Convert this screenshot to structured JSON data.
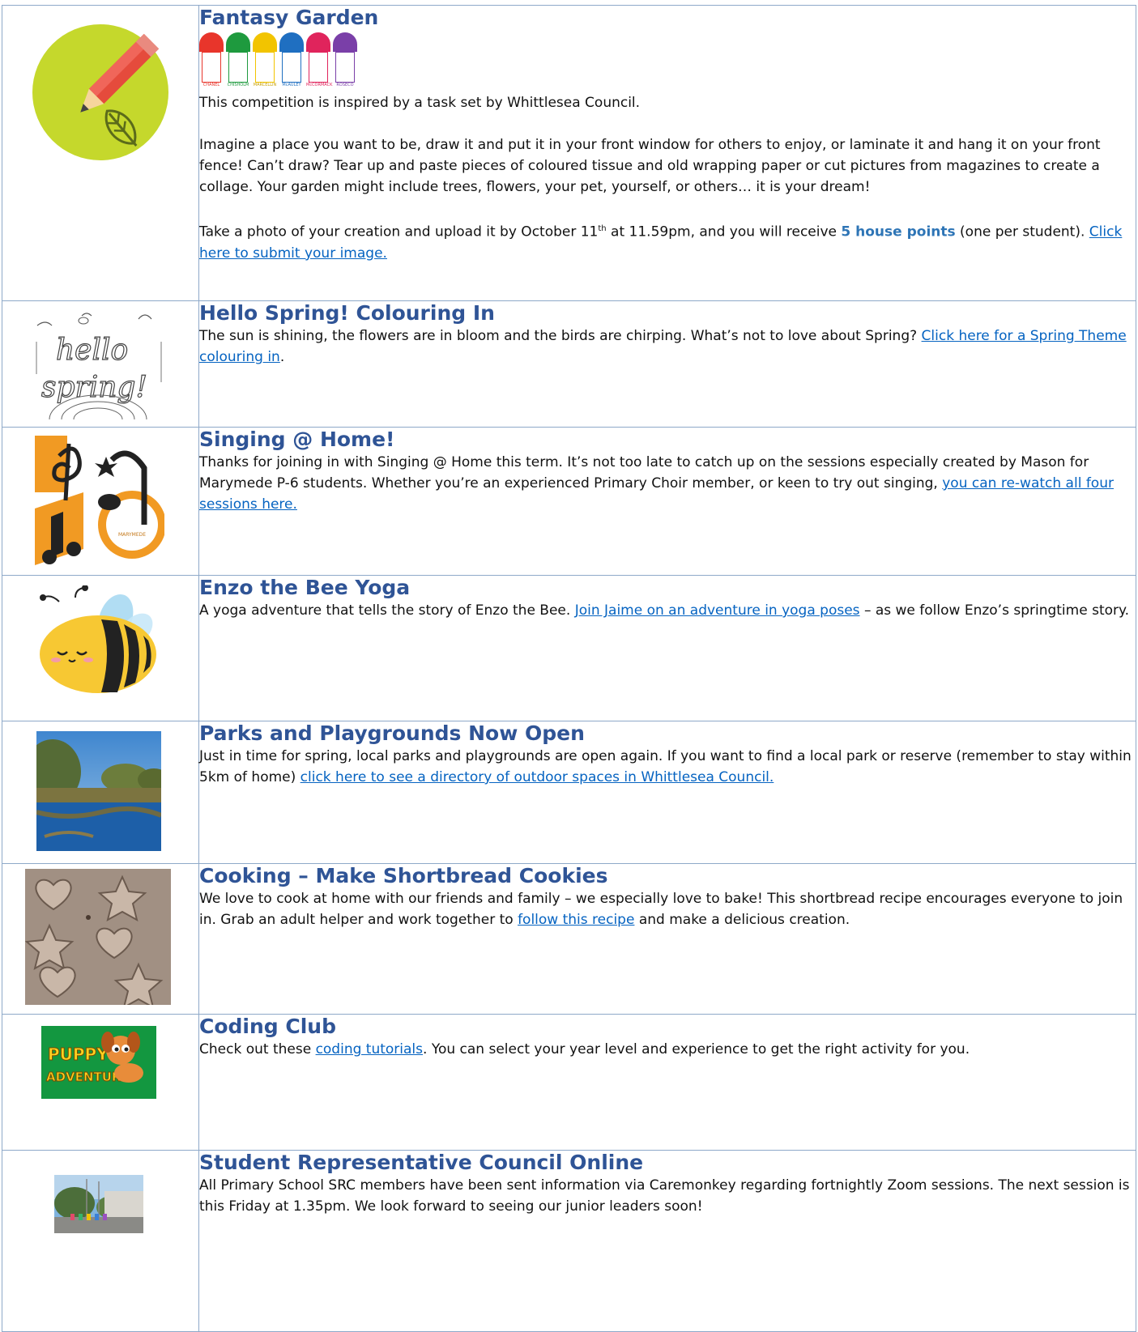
{
  "rows": [
    {
      "title": "Fantasy Garden",
      "houses": [
        {
          "name": "CHANEL",
          "color": "#e8352b"
        },
        {
          "name": "CHISHOLM",
          "color": "#1e9a3e"
        },
        {
          "name": "MARCELLIN",
          "color": "#f2c400"
        },
        {
          "name": "McAULEY",
          "color": "#1f6fc1"
        },
        {
          "name": "McCORMACK",
          "color": "#e0245c"
        },
        {
          "name": "ROSECO",
          "color": "#7a3fa8"
        }
      ],
      "p1": "This competition is inspired by a task set by Whittlesea Council.",
      "p2": "Imagine a place you want to be, draw it and put it in your front window for others to enjoy, or laminate it and hang it on your front fence! Can’t draw? Tear up and paste pieces of coloured tissue and old wrapping paper or cut pictures from magazines to create a collage. Your garden might include trees, flowers, your pet, yourself, or others… it is your dream!",
      "p3a": "Take a photo of your creation and upload it by October 11",
      "p3sup": "th",
      "p3b": " at 11.59pm, and you will receive ",
      "p3bold": "5 house points",
      "p3c": " (one per student). ",
      "p3link": "Click here to submit your image."
    },
    {
      "title": "Hello Spring! Colouring In",
      "p1": "The sun is shining, the flowers are in bloom and the birds are chirping. What’s not to love about Spring? ",
      "link": "Click here for a Spring Theme colouring in",
      "p1end": ".",
      "img_text1": "hello",
      "img_text2": "spring!"
    },
    {
      "title": "Singing @ Home!",
      "p1": "Thanks for joining in with Singing @ Home this term. It’s not too late to catch up on the sessions especially created by Mason for Marymede P-6 students. Whether you’re an experienced Primary Choir member, or keen to try out singing, ",
      "link": "you can re-watch all four sessions here.",
      "img_text": "MARYMEDE"
    },
    {
      "title": "Enzo the Bee Yoga",
      "p1": "A yoga adventure that tells the story of Enzo the Bee. ",
      "link": "Join Jaime on an adventure in yoga poses",
      "p1end": " – as we follow Enzo’s springtime story."
    },
    {
      "title": "Parks and Playgrounds Now Open",
      "p1": "Just in time for spring, local parks and playgrounds are open again. If you want to find a local park or reserve (remember to stay within 5km of home) ",
      "link": "click here to see a directory of outdoor spaces in Whittlesea Council."
    },
    {
      "title": "Cooking – Make Shortbread Cookies",
      "p1": "We love to cook at home with our friends and family – we especially love to bake! This shortbread recipe encourages everyone to join in. Grab an adult helper and work together to ",
      "link": "follow this recipe",
      "p1end": " and make a delicious creation."
    },
    {
      "title": "Coding Club",
      "p1": "Check out these ",
      "link": "coding tutorials",
      "p1end": ". You can select your year level and experience to get the right activity for you.",
      "img_text1": "PUPPY",
      "img_text2": "ADVENTURE"
    },
    {
      "title": "Student Representative Council Online",
      "p1": "All Primary School SRC members have been sent information via Caremonkey regarding fortnightly Zoom sessions. The next session is this Friday at 1.35pm. We look forward to seeing our junior leaders soon!"
    }
  ]
}
